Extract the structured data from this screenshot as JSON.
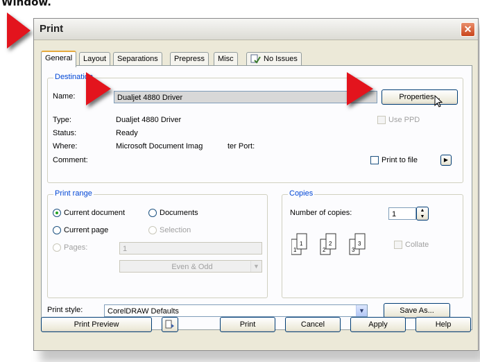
{
  "caption": "Window.",
  "window": {
    "title": "Print",
    "close_icon": "close-icon"
  },
  "tabs": [
    {
      "label": "General",
      "active": true
    },
    {
      "label": "Layout"
    },
    {
      "label": "Separations"
    },
    {
      "label": "Prepress"
    },
    {
      "label": "Misc"
    },
    {
      "label": "No Issues",
      "icon": "doc-check-icon"
    }
  ],
  "destination": {
    "group_label": "Destination",
    "name_label": "Name:",
    "name_value": "Dualjet 4880 Driver",
    "properties_label": "Properties...",
    "type_label": "Type:",
    "type_value": "Dualjet 4880 Driver",
    "status_label": "Status:",
    "status_value": "Ready",
    "where_label": "Where:",
    "where_value": "Microsoft Document Imag",
    "port_label": "ter Port:",
    "comment_label": "Comment:",
    "use_ppd_label": "Use PPD",
    "print_to_file_label": "Print to file"
  },
  "print_range": {
    "group_label": "Print range",
    "current_document_label": "Current document",
    "documents_label": "Documents",
    "current_page_label": "Current page",
    "selection_label": "Selection",
    "pages_label": "Pages:",
    "pages_value": "1",
    "even_odd_value": "Even & Odd",
    "selected": "Current document"
  },
  "copies": {
    "group_label": "Copies",
    "number_label": "Number of copies:",
    "number_value": "1",
    "collate_label": "Collate",
    "icons": [
      "11",
      "22",
      "33"
    ]
  },
  "print_style": {
    "label": "Print style:",
    "value": "CorelDRAW Defaults",
    "save_as_label": "Save As..."
  },
  "footer": {
    "print_preview_label": "Print Preview",
    "print_label": "Print",
    "cancel_label": "Cancel",
    "apply_label": "Apply",
    "help_label": "Help"
  },
  "colors": {
    "pointer": "#e3141d",
    "group_label": "#0046d5"
  }
}
